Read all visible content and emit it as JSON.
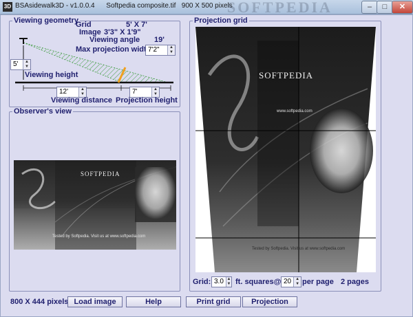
{
  "window": {
    "app_icon": "3D",
    "title": "BSAsidewalk3D - v1.0.0.4      Softpedia composite.tif   900 X 500 pixels",
    "brand_watermark": "SOFTPEDIA",
    "min_label": "–",
    "max_label": "□",
    "close_label": "✕"
  },
  "viewing_geometry": {
    "legend": "Viewing geometry",
    "grid_label": "Grid",
    "grid_value": "5' X 7'",
    "image_label": "Image",
    "image_value": "3'3\" X 1'9\"",
    "viewing_angle_label": "Viewing angle",
    "viewing_angle_value": "19'",
    "max_projection_width_label": "Max projection width",
    "max_projection_width_value": "7'2\"",
    "viewing_height_value": "5'",
    "viewing_height_label": "Viewing height",
    "viewing_distance_value": "12'",
    "viewing_distance_label": "Viewing distance",
    "projection_height_value": "7'",
    "projection_height_label": "Projection height"
  },
  "observers_view": {
    "legend": "Observer's view",
    "brand": "SOFTPEDIA",
    "caption": "Tested by Softpedia. Visit us at www.softpedia.com"
  },
  "projection_grid": {
    "legend": "Projection grid",
    "brand": "SOFTPEDIA",
    "url": "www.softpedia.com",
    "caption": "Tested by Softpedia. Visit us at www.softpedia.com",
    "grid_label": "Grid:",
    "grid_value": "3.0",
    "squares_label": "ft. squares@",
    "per_page_value": "20",
    "per_page_label": "per page",
    "pages": "2 pages"
  },
  "footer": {
    "pixels": "800 X 444 pixels",
    "load_image": "Load image",
    "help": "Help",
    "print_grid": "Print grid",
    "projection": "Projection"
  }
}
